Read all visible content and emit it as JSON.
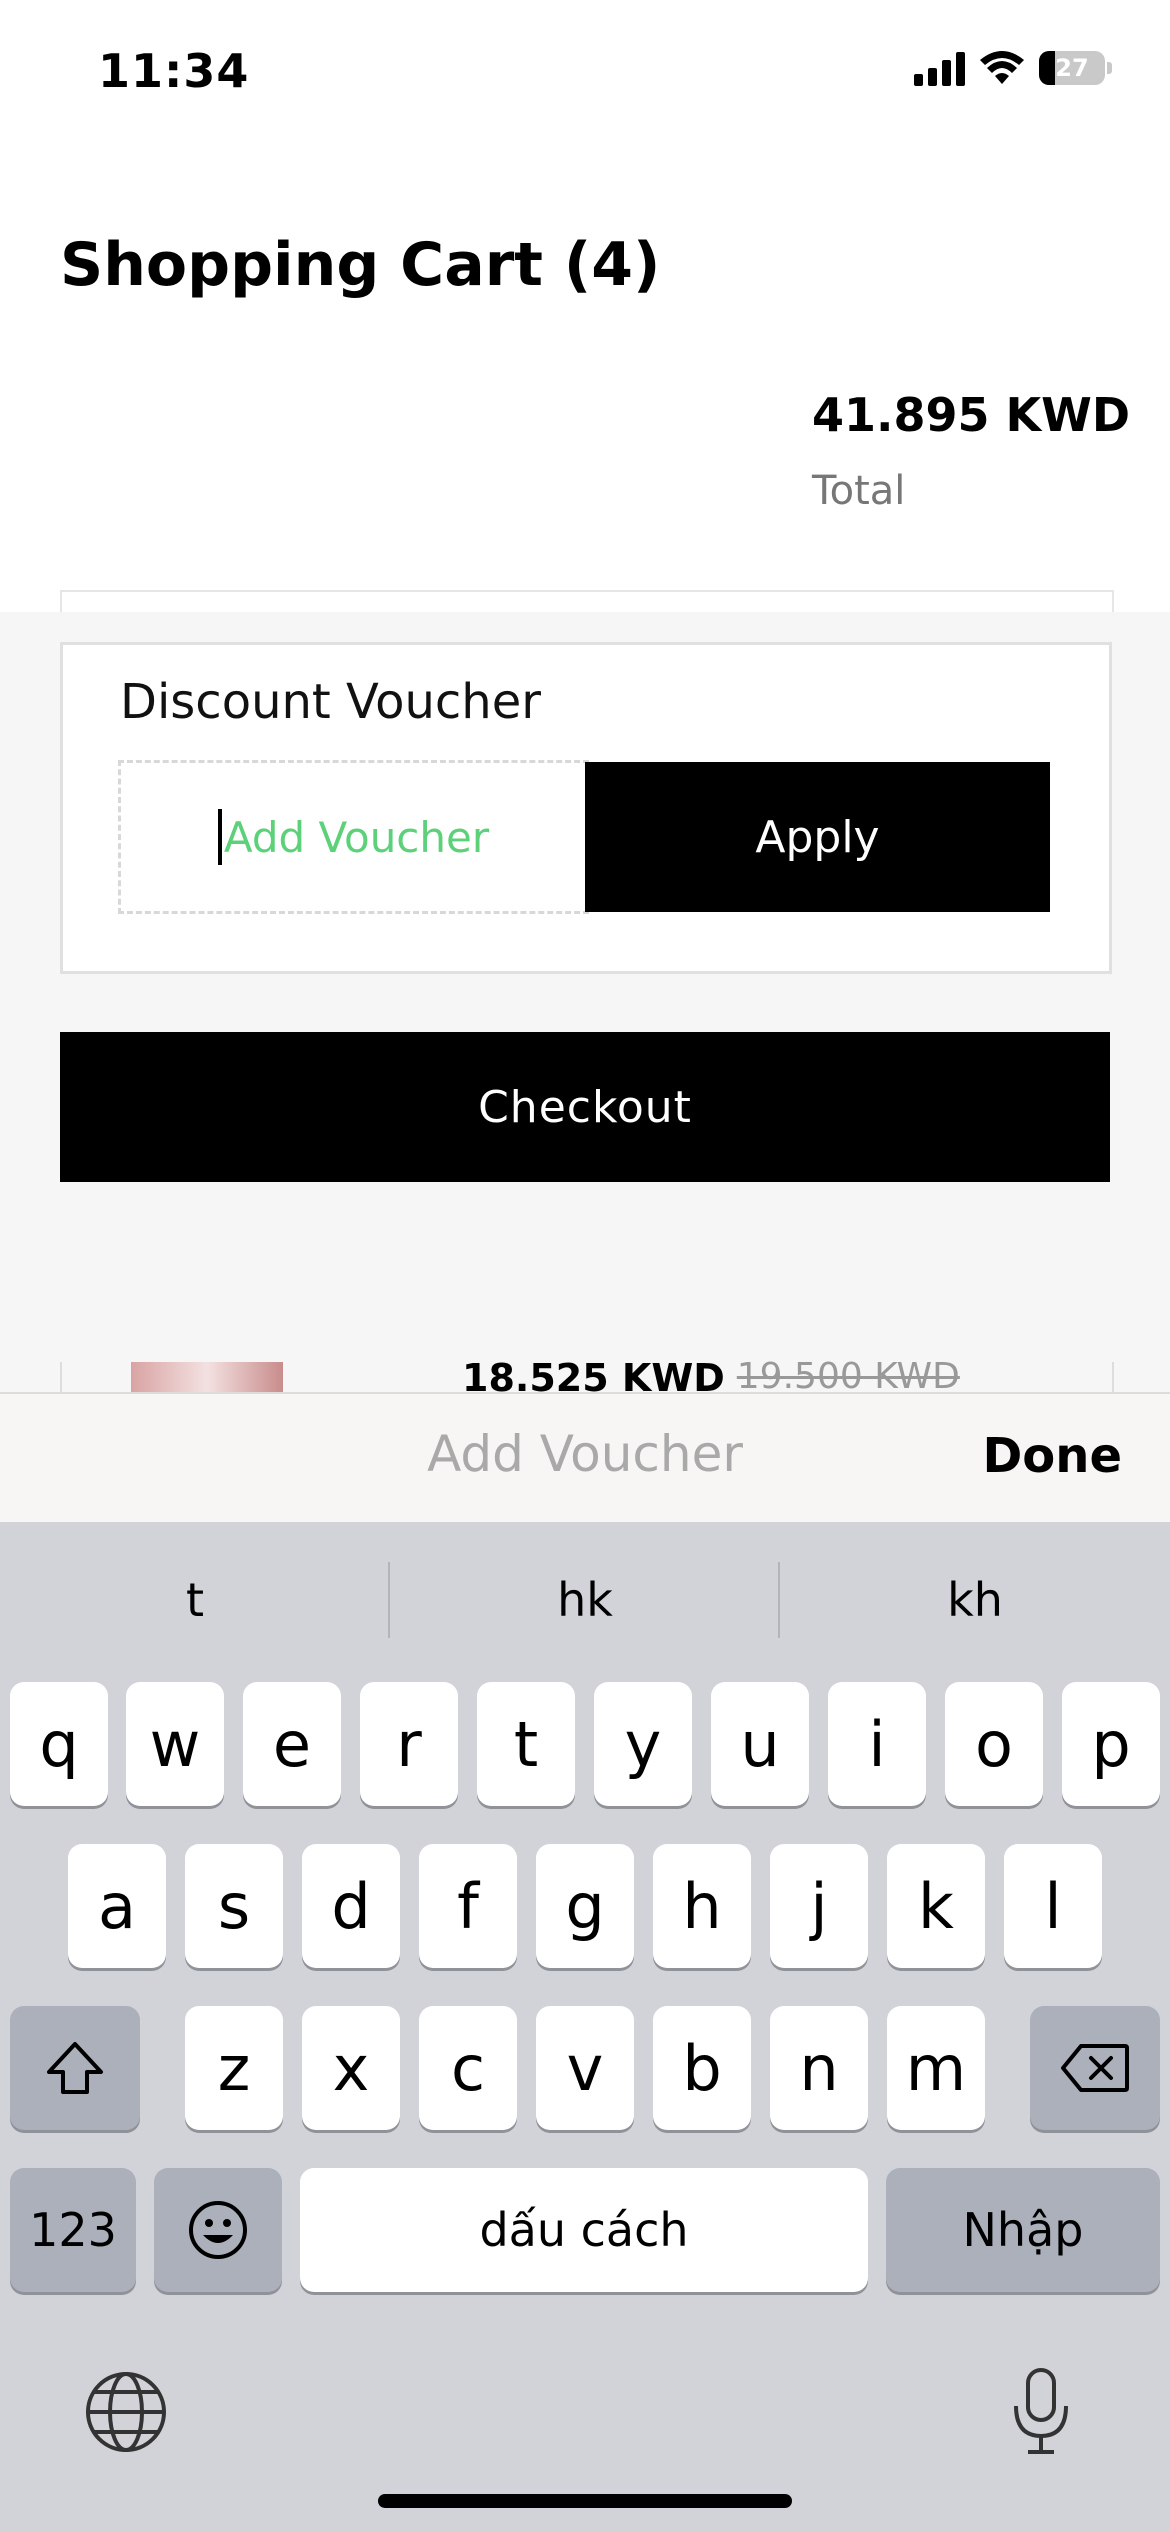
{
  "status_bar": {
    "time": "11:34",
    "battery": "27"
  },
  "cart": {
    "title": "Shopping Cart (4)",
    "total_amount": "41.895 KWD",
    "total_label": "Total",
    "item_price": "18.525 KWD",
    "item_old_price": "19.500 KWD"
  },
  "voucher": {
    "title": "Discount Voucher",
    "placeholder": "Add Voucher",
    "apply_label": "Apply"
  },
  "checkout_label": "Checkout",
  "accessory_bar": {
    "placeholder": "Add Voucher",
    "done_label": "Done"
  },
  "keyboard": {
    "suggestions": [
      "t",
      "hk",
      "kh"
    ],
    "row1": [
      "q",
      "w",
      "e",
      "r",
      "t",
      "y",
      "u",
      "i",
      "o",
      "p"
    ],
    "row2": [
      "a",
      "s",
      "d",
      "f",
      "g",
      "h",
      "j",
      "k",
      "l"
    ],
    "row3": [
      "z",
      "x",
      "c",
      "v",
      "b",
      "n",
      "m"
    ],
    "numbers_label": "123",
    "space_label": "dấu cách",
    "return_label": "Nhập"
  },
  "accent_color": "#5cd17a"
}
